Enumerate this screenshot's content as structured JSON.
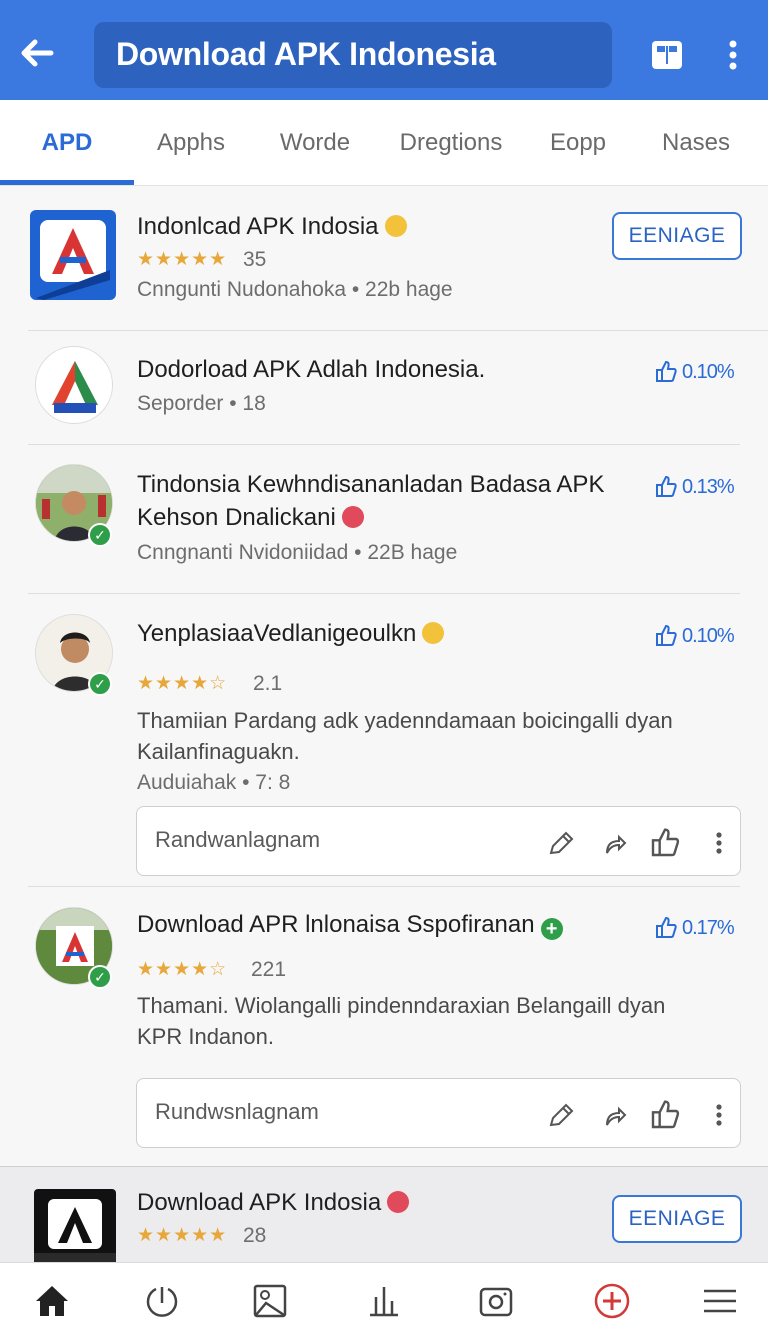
{
  "header": {
    "title": "Download APK Indonesia",
    "back_icon": "arrow-left-icon",
    "right_icons": [
      "card-view-icon",
      "more-vert-icon"
    ],
    "accent": "#3b78e0"
  },
  "tabs": [
    {
      "label": "APD",
      "active": true
    },
    {
      "label": "Apphs",
      "active": false
    },
    {
      "label": "Worde",
      "active": false
    },
    {
      "label": "Dregtions",
      "active": false
    },
    {
      "label": "Eopp",
      "active": false
    },
    {
      "label": "Nases",
      "active": false
    }
  ],
  "items": [
    {
      "name": "Indonlcad APK Indosia",
      "stars": "★★★★★",
      "rating": "35",
      "meta": "Cnngunti Nudonahoka • 22b hage",
      "action": "EENIAGE"
    },
    {
      "name": "Dodorload APK Adlah Indonesia.",
      "meta": "Seporder • 18",
      "percent": "0.10%"
    },
    {
      "name_line1": "Tindonsia Kewhndisananladan Badasa APK",
      "name_line2": "Kehson Dnalickani",
      "meta": "Cnngnanti Nvidoniidad • 22B hage",
      "percent": "0.13%"
    },
    {
      "name": "YenplasiaaVedlanigeoulkn",
      "stars": "★★★★☆",
      "rating": "2.1",
      "desc_line1": "Thamiian Pardang adk yadenndamaan boicingalli dyan",
      "desc_line2": "Kailanfinaguakn.",
      "meta": "Auduiahak • 7: 8",
      "percent": "0.10%",
      "reply_placeholder": "Randwanlagnam"
    },
    {
      "name": "Download APR lnlonaisa Sspofiranan",
      "stars": "★★★★☆",
      "rating": "221",
      "desc_line1": "Thamani. Wiolangalli pindenndaraxian Belangaill dyan",
      "desc_line2": "KPR Indanon.",
      "percent": "0.17%",
      "reply_placeholder": "Rundwsnlagnam"
    },
    {
      "name": "Download APK Indosia",
      "stars": "★★★★★",
      "rating": "28",
      "action": "EENIAGE"
    }
  ],
  "reply_icons": [
    "edit-icon",
    "share-icon",
    "thumbs-up-icon",
    "more-vert-icon"
  ],
  "bottom_nav": [
    "home-icon",
    "history-icon",
    "gallery-icon",
    "stats-icon",
    "camera-icon",
    "add-circle-icon",
    "menu-icon"
  ]
}
